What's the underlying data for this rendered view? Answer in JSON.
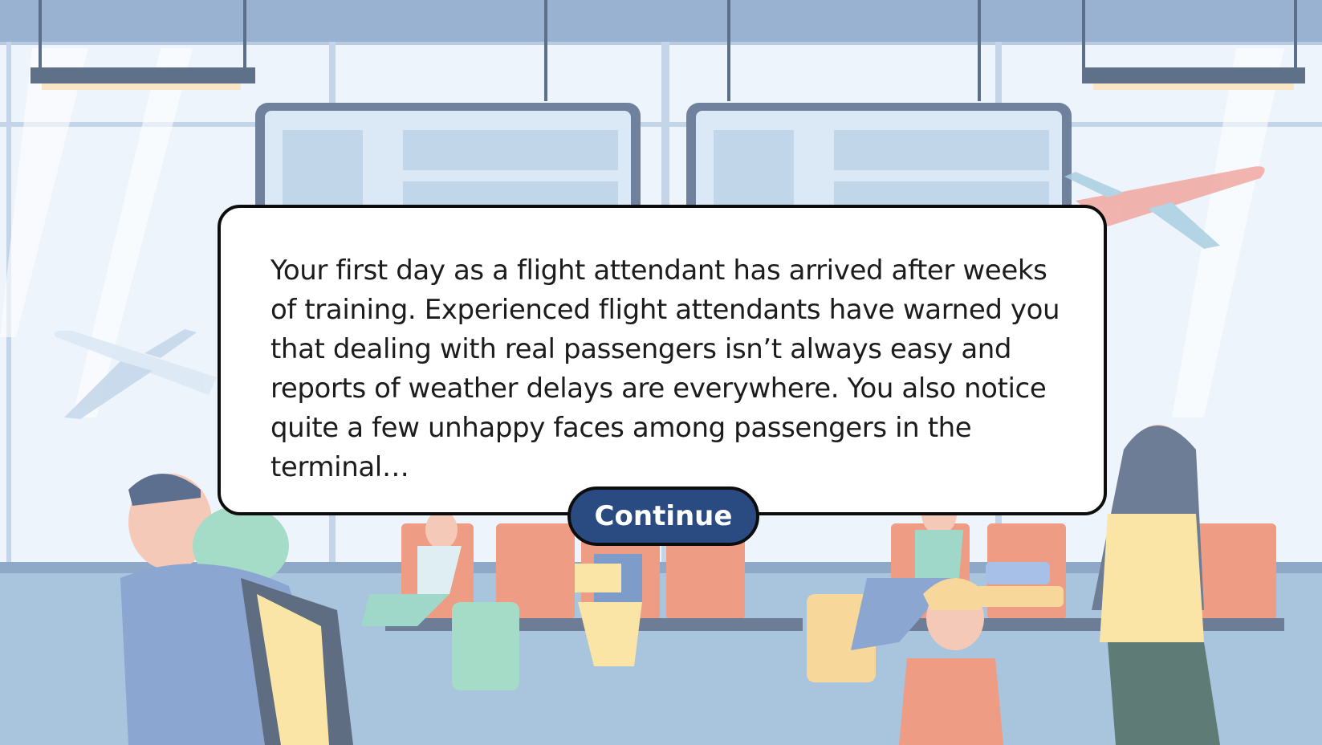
{
  "dialog": {
    "text": "Your first day as a flight attendant has arrived after weeks of training. Experienced flight attendants have warned you that dealing with real passengers isn’t always easy and reports of weather delays are everywhere. You also notice quite a few unhappy faces among passengers in the terminal…"
  },
  "continue_button": {
    "label": "Continue"
  },
  "scene": {
    "illustration": "airport-terminal-background",
    "colors": {
      "sky": "#eaf2fb",
      "ceiling": "#9bb3d3",
      "floor": "#a9c4dd",
      "seats": "#ef9f87",
      "button": "#2a4a82"
    }
  }
}
